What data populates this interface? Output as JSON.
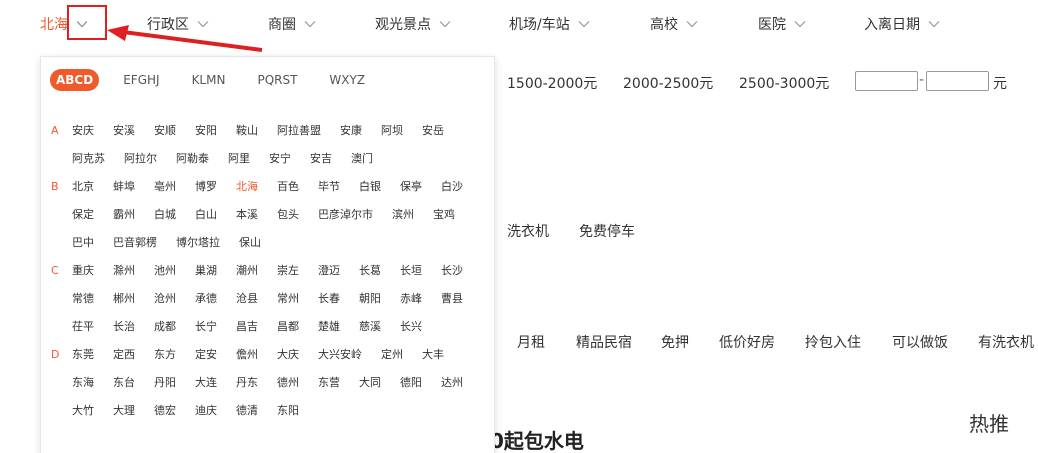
{
  "topbar": {
    "items": [
      {
        "label": "北海",
        "active": true
      },
      {
        "label": "行政区"
      },
      {
        "label": "商圈"
      },
      {
        "label": "观光景点"
      },
      {
        "label": "机场/车站"
      },
      {
        "label": "高校"
      },
      {
        "label": "医院"
      },
      {
        "label": "入离日期"
      }
    ]
  },
  "background": {
    "prices": [
      "1500-2000元",
      "2000-2500元",
      "2500-3000元"
    ],
    "price_unit": "元",
    "price_sep": "-",
    "facilities": [
      "洗衣机",
      "免费停车"
    ],
    "tags": [
      "月租",
      "精品民宿",
      "免押",
      "低价好房",
      "拎包入住",
      "可以做饭",
      "有洗衣机"
    ],
    "heading_fragment": "0起包水电",
    "hot": "热推"
  },
  "dropdown": {
    "tabs": [
      "ABCD",
      "EFGHJ",
      "KLMN",
      "PQRST",
      "WXYZ"
    ],
    "selected_city": "北海",
    "groups": [
      {
        "letter": "A",
        "cities": [
          "安庆",
          "安溪",
          "安顺",
          "安阳",
          "鞍山",
          "阿拉善盟",
          "安康",
          "阿坝",
          "安岳",
          "阿克苏",
          "阿拉尔",
          "阿勒泰",
          "阿里",
          "安宁",
          "安吉",
          "澳门"
        ]
      },
      {
        "letter": "B",
        "cities": [
          "北京",
          "蚌埠",
          "亳州",
          "博罗",
          "北海",
          "百色",
          "毕节",
          "白银",
          "保亭",
          "白沙",
          "保定",
          "霸州",
          "白城",
          "白山",
          "本溪",
          "包头",
          "巴彦淖尔市",
          "滨州",
          "宝鸡",
          "巴中",
          "巴音郭楞",
          "博尔塔拉",
          "保山"
        ]
      },
      {
        "letter": "C",
        "cities": [
          "重庆",
          "滁州",
          "池州",
          "巢湖",
          "潮州",
          "崇左",
          "澄迈",
          "长葛",
          "长垣",
          "长沙",
          "常德",
          "郴州",
          "沧州",
          "承德",
          "沧县",
          "常州",
          "长春",
          "朝阳",
          "赤峰",
          "曹县",
          "茌平",
          "长治",
          "成都",
          "长宁",
          "昌吉",
          "昌都",
          "楚雄",
          "慈溪",
          "长兴"
        ]
      },
      {
        "letter": "D",
        "cities": [
          "东莞",
          "定西",
          "东方",
          "定安",
          "儋州",
          "大庆",
          "大兴安岭",
          "定州",
          "大丰",
          "东海",
          "东台",
          "丹阳",
          "大连",
          "丹东",
          "德州",
          "东营",
          "大同",
          "德阳",
          "达州",
          "大竹",
          "大理",
          "德宏",
          "迪庆",
          "德清",
          "东阳"
        ]
      }
    ]
  }
}
